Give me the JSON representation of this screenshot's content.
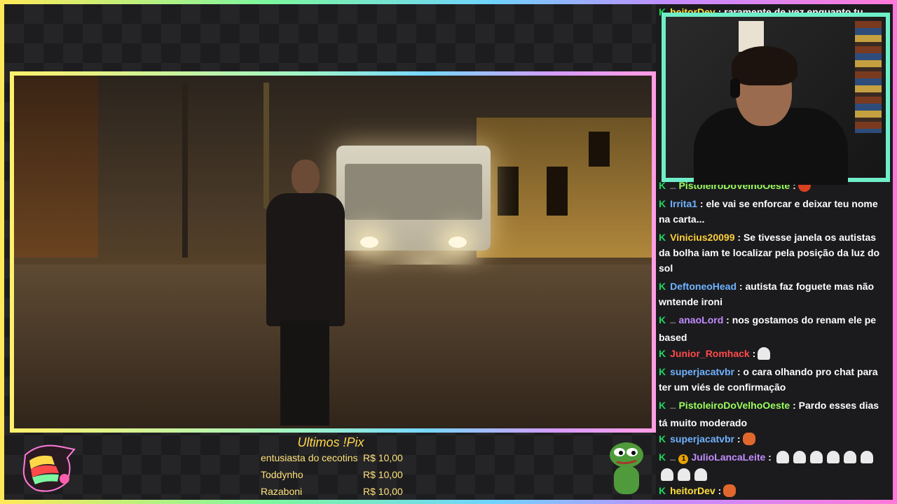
{
  "chat": {
    "messages": [
      {
        "user": "heitorDev",
        "user_color": "#ffdf3b",
        "text": " : raramente de vez enquanto tu",
        "badges": []
      },
      {
        "user": "PistoleiroDoVelhoOeste",
        "user_color": "#9aff5a",
        "text": " :",
        "badges": [
          "..."
        ],
        "emotes": [
          "tomato"
        ]
      },
      {
        "user": "Irrita1",
        "user_color": "#6fb3ff",
        "text": " : ele vai se enforcar e deixar teu nome na carta...",
        "badges": []
      },
      {
        "user": "Vinicius20099",
        "user_color": "#ffcf3a",
        "text": " : Se tivesse janela os autistas da bolha iam te localizar pela posição da luz do sol",
        "badges": []
      },
      {
        "user": "DeftoneoHead",
        "user_color": "#6fb3ff",
        "text": " : autista faz foguete mas não wntende ironi",
        "badges": []
      },
      {
        "user": "anaoLord",
        "user_color": "#c38cff",
        "text": " : nos gostamos do renam ele pe based",
        "badges": [
          "..."
        ]
      },
      {
        "user": "Junior_Romhack",
        "user_color": "#ff4a4a",
        "text": " :",
        "badges": [],
        "emotes": [
          "ghost"
        ]
      },
      {
        "user": "superjacatvbr",
        "user_color": "#6fb3ff",
        "text": " : o cara olhando pro chat para ter um viés de confirmação",
        "badges": []
      },
      {
        "user": "PistoleiroDoVelhoOeste",
        "user_color": "#9aff5a",
        "text": " : Pardo esses dias tá muito moderado",
        "badges": [
          "..."
        ]
      },
      {
        "user": "superjacatvbr",
        "user_color": "#6fb3ff",
        "text": " :",
        "badges": [],
        "emotes": [
          "crab"
        ]
      },
      {
        "user": "JulioLancaLeite",
        "user_color": "#c38cff",
        "text": " :",
        "badges": [
          "...",
          "1"
        ],
        "emotes": [
          "ghost",
          "ghost",
          "ghost",
          "ghost",
          "ghost",
          "ghost",
          "ghost",
          "ghost",
          "ghost"
        ]
      },
      {
        "user": "heitorDev",
        "user_color": "#ffdf3b",
        "text": " :",
        "badges": [],
        "emotes": [
          "crab"
        ]
      }
    ]
  },
  "pix": {
    "title": "Ultimos !Pix",
    "donations": [
      {
        "name": "entusiasta do cecotins",
        "amount": "R$ 10,00"
      },
      {
        "name": "Toddynho",
        "amount": "R$ 10,00"
      },
      {
        "name": "Razaboni",
        "amount": "R$ 10,00"
      }
    ]
  },
  "colors": {
    "accent_green": "#1ed760",
    "frame_gradient": [
      "#ffe95a",
      "#7cf7a0",
      "#6fd3ff",
      "#c38cff",
      "#ff7ad9"
    ]
  },
  "icons": {
    "chat_badge": "k-badge-icon",
    "logo": "bird-logo-icon",
    "pepe": "pepe-icon"
  }
}
